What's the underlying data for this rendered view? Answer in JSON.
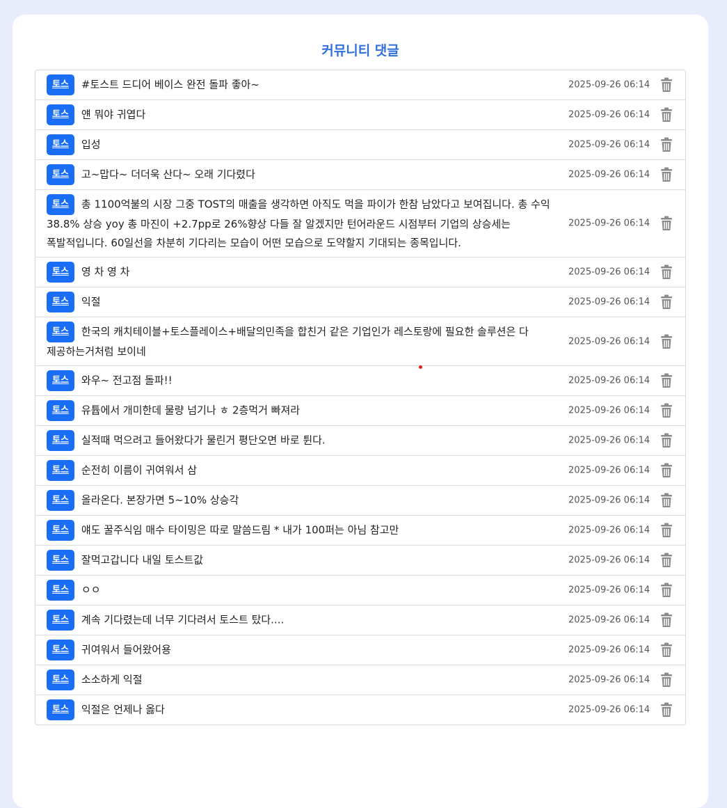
{
  "page": {
    "title": "커뮤니티 댓글"
  },
  "colors": {
    "accent": "#2f6fdc",
    "badge": "#1a6ef5",
    "background": "#e8edfb"
  },
  "comments": [
    {
      "badge": "토스",
      "text": "#토스트 드디어 베이스 완전 돌파 좋아~",
      "time": "2025-09-26 06:14"
    },
    {
      "badge": "토스",
      "text": "얜 뭐야 귀엽다",
      "time": "2025-09-26 06:14"
    },
    {
      "badge": "토스",
      "text": "입성",
      "time": "2025-09-26 06:14"
    },
    {
      "badge": "토스",
      "text": "고~맙다~ 더더욱 산다~ 오래 기다렸다",
      "time": "2025-09-26 06:14"
    },
    {
      "badge": "토스",
      "text": "총 1100억불의 시장 그중 TOST의 매출을 생각하면 아직도 먹을 파이가 한참 남았다고 보여집니다. 총 수익 38.8% 상승 yoy 총 마진이 +2.7pp로 26%향상 다들 잘 알겠지만 턴어라운드 시점부터 기업의 상승세는 폭발적입니다. 60일선을 차분히 기다리는 모습이 어떤 모습으로 도약할지 기대되는 종목입니다.",
      "time": "2025-09-26 06:14"
    },
    {
      "badge": "토스",
      "text": "영 차 영 차",
      "time": "2025-09-26 06:14"
    },
    {
      "badge": "토스",
      "text": "익절",
      "time": "2025-09-26 06:14"
    },
    {
      "badge": "토스",
      "text": "한국의 캐치테이블+토스플레이스+배달의민족을 합친거 같은 기업인가 레스토랑에 필요한 솔루션은 다 제공하는거처럼 보이네",
      "time": "2025-09-26 06:14"
    },
    {
      "badge": "토스",
      "text": "와우~ 전고점 돌파!!",
      "time": "2025-09-26 06:14"
    },
    {
      "badge": "토스",
      "text": "유튭에서 개미한데 물량 넘기나 ㅎ 2층먹거 빠져라",
      "time": "2025-09-26 06:14"
    },
    {
      "badge": "토스",
      "text": "실적때 먹으려고 들어왔다가 물린거 평단오면 바로 튄다.",
      "time": "2025-09-26 06:14"
    },
    {
      "badge": "토스",
      "text": "순전히 이름이 귀여워서 삼",
      "time": "2025-09-26 06:14"
    },
    {
      "badge": "토스",
      "text": "올라온다. 본장가면 5~10% 상승각",
      "time": "2025-09-26 06:14"
    },
    {
      "badge": "토스",
      "text": "얘도 꿀주식임 매수 타이밍은 따로 말씀드림 * 내가 100퍼는 아님 참고만",
      "time": "2025-09-26 06:14"
    },
    {
      "badge": "토스",
      "text": "잘먹고갑니다 내일 토스트값",
      "time": "2025-09-26 06:14"
    },
    {
      "badge": "토스",
      "text": "ㅇㅇ",
      "time": "2025-09-26 06:14"
    },
    {
      "badge": "토스",
      "text": "계속 기다렸는데 너무 기다려서 토스트 탔다....",
      "time": "2025-09-26 06:14"
    },
    {
      "badge": "토스",
      "text": "귀여워서 들어왔어용",
      "time": "2025-09-26 06:14"
    },
    {
      "badge": "토스",
      "text": "소소하게 익절",
      "time": "2025-09-26 06:14"
    },
    {
      "badge": "토스",
      "text": "익절은 언제나 옳다",
      "time": "2025-09-26 06:14"
    }
  ]
}
